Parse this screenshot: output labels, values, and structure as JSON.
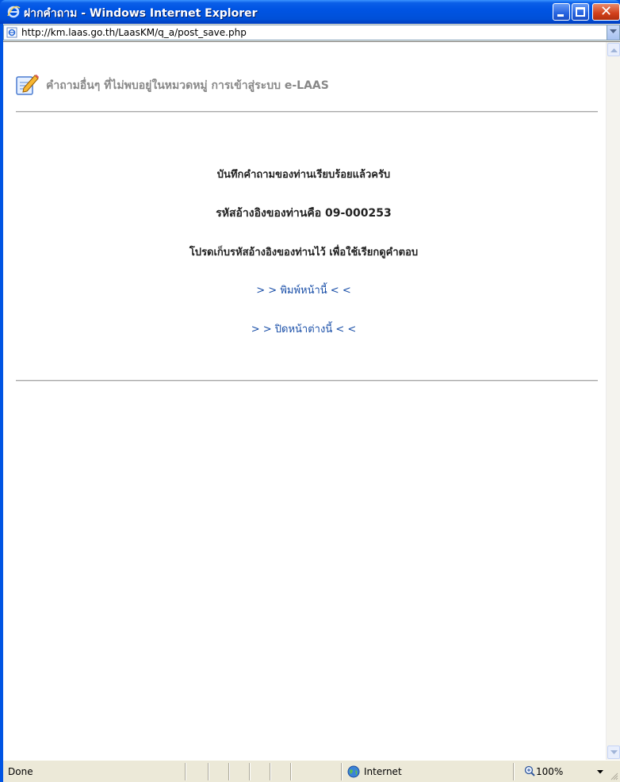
{
  "window": {
    "title": "ฝากคำถาม - Windows Internet Explorer",
    "titlebar_color": "#0054e3",
    "buttons": {
      "minimize_icon": "minimize-icon",
      "maximize_icon": "maximize-icon",
      "close_icon": "close-icon"
    }
  },
  "address": {
    "url": "http://km.laas.go.th/LaasKM/q_a/post_save.php",
    "page_icon": "ie-page-icon"
  },
  "page": {
    "header_icon": "pencil-notepad-icon",
    "header_text": "คำถามอื่นๆ ที่ไม่พบอยู่ในหมวดหมู่ การเข้าสู่ระบบ e-LAAS",
    "message_saved": "บันทึกคำถามของท่านเรียบร้อยแล้วครับ",
    "message_ref": "รหัสอ้างอิงของท่านคือ 09-000253",
    "message_keep": "โปรดเก็บรหัสอ้างอิงของท่านไว้ เพื่อใช้เรียกดูคำตอบ",
    "link_print": "> > พิมพ์หน้านี้ < <",
    "link_close": "> > ปิดหน้าต่างนี้ < <",
    "link_color": "#1a4fa8"
  },
  "status": {
    "text": "Done",
    "zone": "Internet",
    "zone_icon": "globe-icon",
    "zoom": "100%",
    "zoom_icon": "magnifier-icon"
  }
}
